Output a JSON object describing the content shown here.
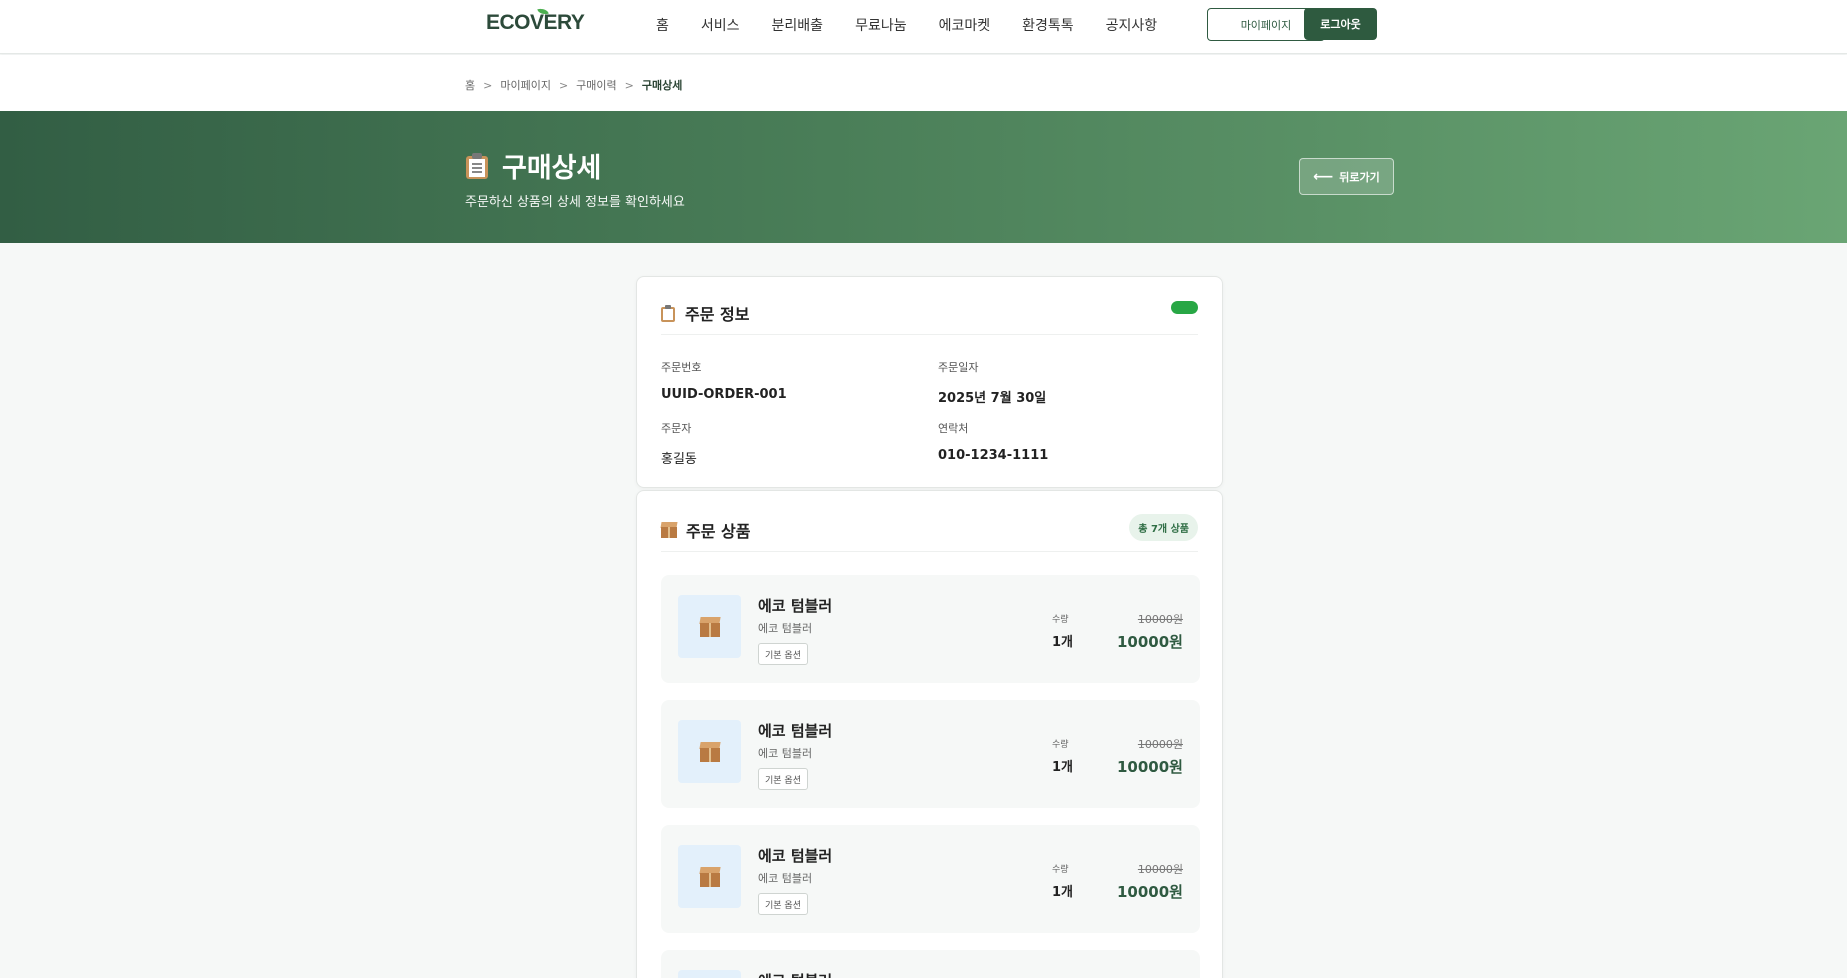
{
  "header": {
    "logo": "ECOVERY",
    "nav": [
      "홈",
      "서비스",
      "분리배출",
      "무료나눔",
      "에코마켓",
      "환경톡톡",
      "공지사항"
    ],
    "mypage_label": "마이페이지",
    "logout_label": "로그아웃"
  },
  "breadcrumb": {
    "items": [
      "홈",
      "마이페이지",
      "구매이력"
    ],
    "current": "구매상세",
    "separator": ">"
  },
  "hero": {
    "title": "구매상세",
    "subtitle": "주문하신 상품의 상세 정보를 확인하세요",
    "back_label": "뒤로가기"
  },
  "order_info": {
    "title": "주문 정보",
    "status_color": "#28a745",
    "order_no_label": "주문번호",
    "order_no": "UUID-ORDER-001",
    "order_date_label": "주문일자",
    "order_date": "2025년 7월 30일",
    "orderer_label": "주문자",
    "orderer": "홍길동",
    "contact_label": "연락처",
    "contact": "010-1234-1111"
  },
  "order_items": {
    "title": "주문 상품",
    "count_label": "총 7개 상품",
    "qty_label": "수량",
    "items": [
      {
        "name": "에코 텀블러",
        "desc": "에코 텀블러",
        "option": "기본 옵션",
        "qty": "1개",
        "price_old": "10000원",
        "price": "10000원"
      },
      {
        "name": "에코 텀블러",
        "desc": "에코 텀블러",
        "option": "기본 옵션",
        "qty": "1개",
        "price_old": "10000원",
        "price": "10000원"
      },
      {
        "name": "에코 텀블러",
        "desc": "에코 텀블러",
        "option": "기본 옵션",
        "qty": "1개",
        "price_old": "10000원",
        "price": "10000원"
      },
      {
        "name": "에코 텀블러"
      }
    ]
  },
  "colors": {
    "brand_dark": "#2e5a3f",
    "hero_start": "#325e44",
    "hero_end": "#6aa574"
  }
}
